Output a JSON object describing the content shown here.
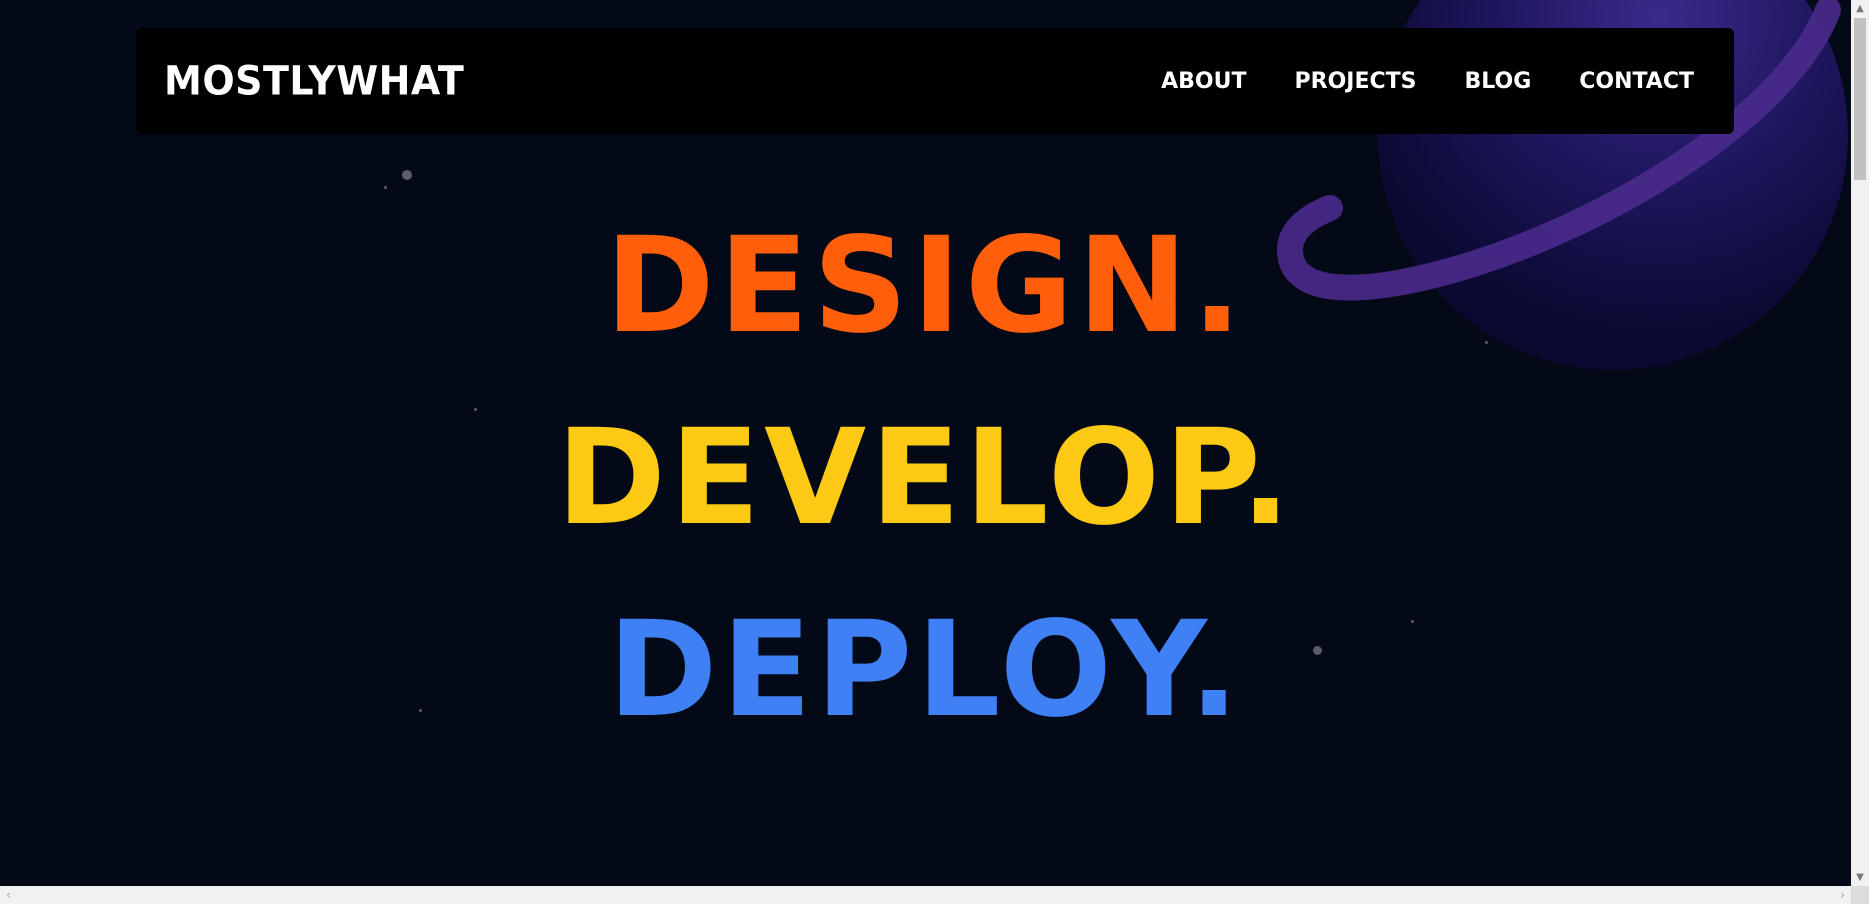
{
  "brand": {
    "name": "MOSTLYWHAT"
  },
  "nav": {
    "items": [
      {
        "label": "ABOUT"
      },
      {
        "label": "PROJECTS"
      },
      {
        "label": "BLOG"
      },
      {
        "label": "CONTACT"
      }
    ]
  },
  "hero": {
    "lines": [
      {
        "text": "DESIGN.",
        "color": "#ff5f0a"
      },
      {
        "text": "DEVELOP.",
        "color": "#fcc914"
      },
      {
        "text": "DEPLOY.",
        "color": "#3f80f4"
      }
    ]
  },
  "colors": {
    "background": "#030916",
    "navbar": "#000000",
    "planet": "#1f1760",
    "ring": "#4a2a8c"
  },
  "scrollbars": {
    "up_icon": "chevron-up-icon",
    "down_icon": "chevron-down-icon",
    "left_icon": "chevron-left-icon",
    "right_icon": "chevron-right-icon"
  }
}
